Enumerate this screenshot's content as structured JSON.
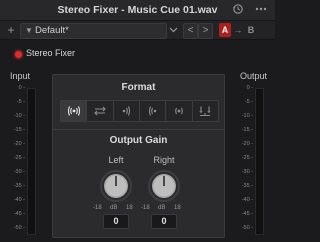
{
  "window": {
    "title": "Stereo Fixer - Music Cue 01.wav",
    "history_icon": "history-icon",
    "menu_icon": "more-menu-icon"
  },
  "toolbar": {
    "add_label": "+",
    "preset_value": "Default*",
    "prev_label": "<",
    "next_label": ">",
    "ab_a": "A",
    "ab_arrow": "→",
    "ab_b": "B"
  },
  "plugin": {
    "name": "Stereo Fixer",
    "power_color": "#e02a2a"
  },
  "meters": {
    "input_label": "Input",
    "output_label": "Output",
    "scale": [
      "0 -",
      "-5 -",
      "-10 -",
      "-15 -",
      "-20 -",
      "-25 -",
      "-30 -",
      "-35 -",
      "-40 -",
      "-45 -",
      "-50 -"
    ]
  },
  "format": {
    "title": "Format",
    "buttons": [
      {
        "icon": "stereo-icon",
        "active": true
      },
      {
        "icon": "swap-channels-icon",
        "active": false
      },
      {
        "icon": "right-only-icon",
        "active": false
      },
      {
        "icon": "left-only-icon",
        "active": false
      },
      {
        "icon": "mono-icon",
        "active": false
      },
      {
        "icon": "invert-phase-icon",
        "active": false
      }
    ]
  },
  "output_gain": {
    "title": "Output Gain",
    "left": {
      "label": "Left",
      "value": "0",
      "scale_min": "-18",
      "scale_mid": "dB",
      "scale_max": "18"
    },
    "right": {
      "label": "Right",
      "value": "0",
      "scale_min": "-18",
      "scale_mid": "dB",
      "scale_max": "18"
    }
  },
  "colors": {
    "accent_red": "#e02a2a",
    "ab_red": "#b01d1d"
  }
}
